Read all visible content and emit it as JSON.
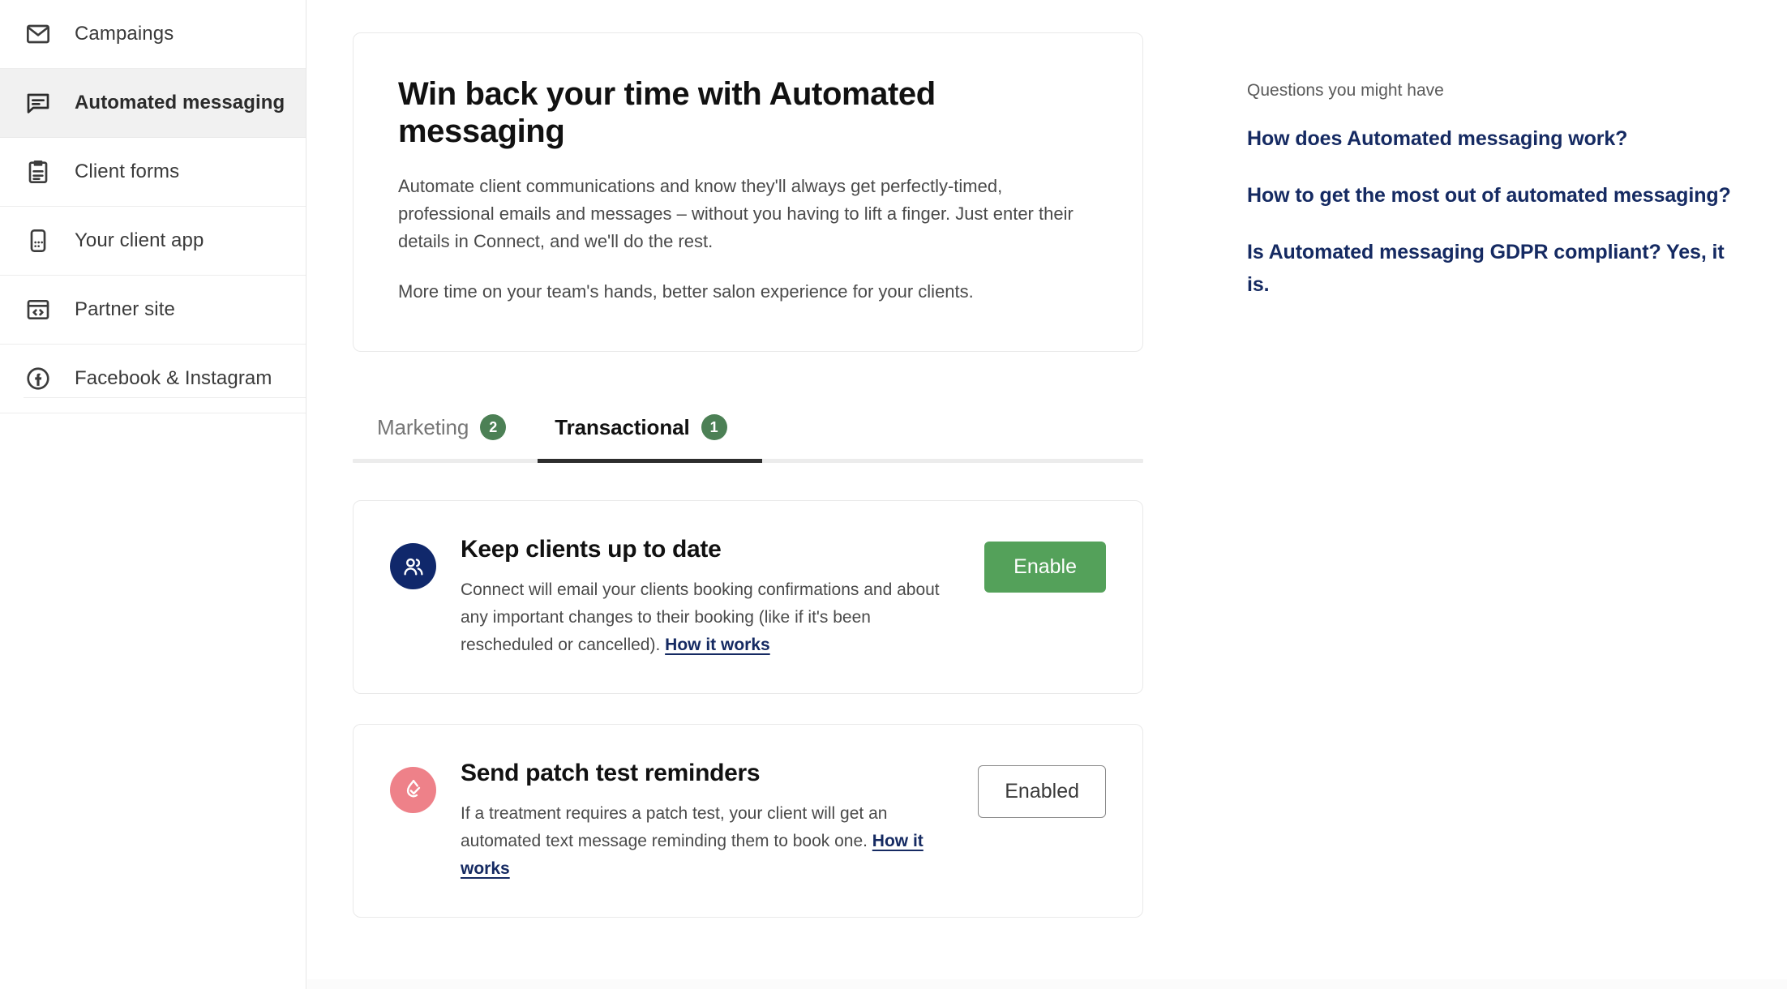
{
  "sidebar": {
    "items": [
      {
        "label": "Campaings",
        "icon": "envelope-icon",
        "active": false
      },
      {
        "label": "Automated messaging",
        "icon": "chat-bubble-icon",
        "active": true
      },
      {
        "label": "Client forms",
        "icon": "clipboard-icon",
        "active": false
      },
      {
        "label": "Your client app",
        "icon": "mobile-app-icon",
        "active": false
      },
      {
        "label": "Partner site",
        "icon": "code-window-icon",
        "active": false
      },
      {
        "label": "Facebook & Instagram",
        "icon": "facebook-icon",
        "active": false
      }
    ]
  },
  "hero": {
    "title": "Win back your time with Automated messaging",
    "paragraph1": "Automate client communications and know they'll always get perfectly-timed, professional emails and messages – without you having to lift a finger. Just enter their details in Connect, and we'll do the rest.",
    "paragraph2": "More time on your team's hands, better salon experience for your clients."
  },
  "tabs": [
    {
      "label": "Marketing",
      "badge": "2",
      "active": false
    },
    {
      "label": "Transactional",
      "badge": "1",
      "active": true
    }
  ],
  "features": [
    {
      "icon": "people-icon",
      "icon_bg": "#10286b",
      "title": "Keep clients up to date",
      "desc_before_link": "Connect will email your clients booking confirmations and about any important changes to their booking (like if it's been rescheduled or cancelled). ",
      "link_label": "How it works",
      "desc_after_link": "",
      "action_label": "Enable",
      "action_style": "primary"
    },
    {
      "icon": "droplet-check-icon",
      "icon_bg": "#ee8189",
      "title": "Send patch test reminders",
      "desc_before_link": "If a treatment requires a patch test, your client will get an automated text message reminding them to book one. ",
      "link_label": "How it works",
      "desc_after_link": "",
      "action_label": "Enabled",
      "action_style": "outline"
    }
  ],
  "rail": {
    "heading": "Questions you might have",
    "links": [
      "How does Automated messaging work?",
      "How to get the most out of automated messaging?",
      "Is Automated messaging GDPR compliant? Yes, it is."
    ]
  },
  "colors": {
    "accent_green": "#54a15a",
    "badge_green": "#4c8055",
    "link_navy": "#152a62",
    "active_nav_bg": "#f1f1f1",
    "tab_indicator": "#2d2d2d"
  }
}
